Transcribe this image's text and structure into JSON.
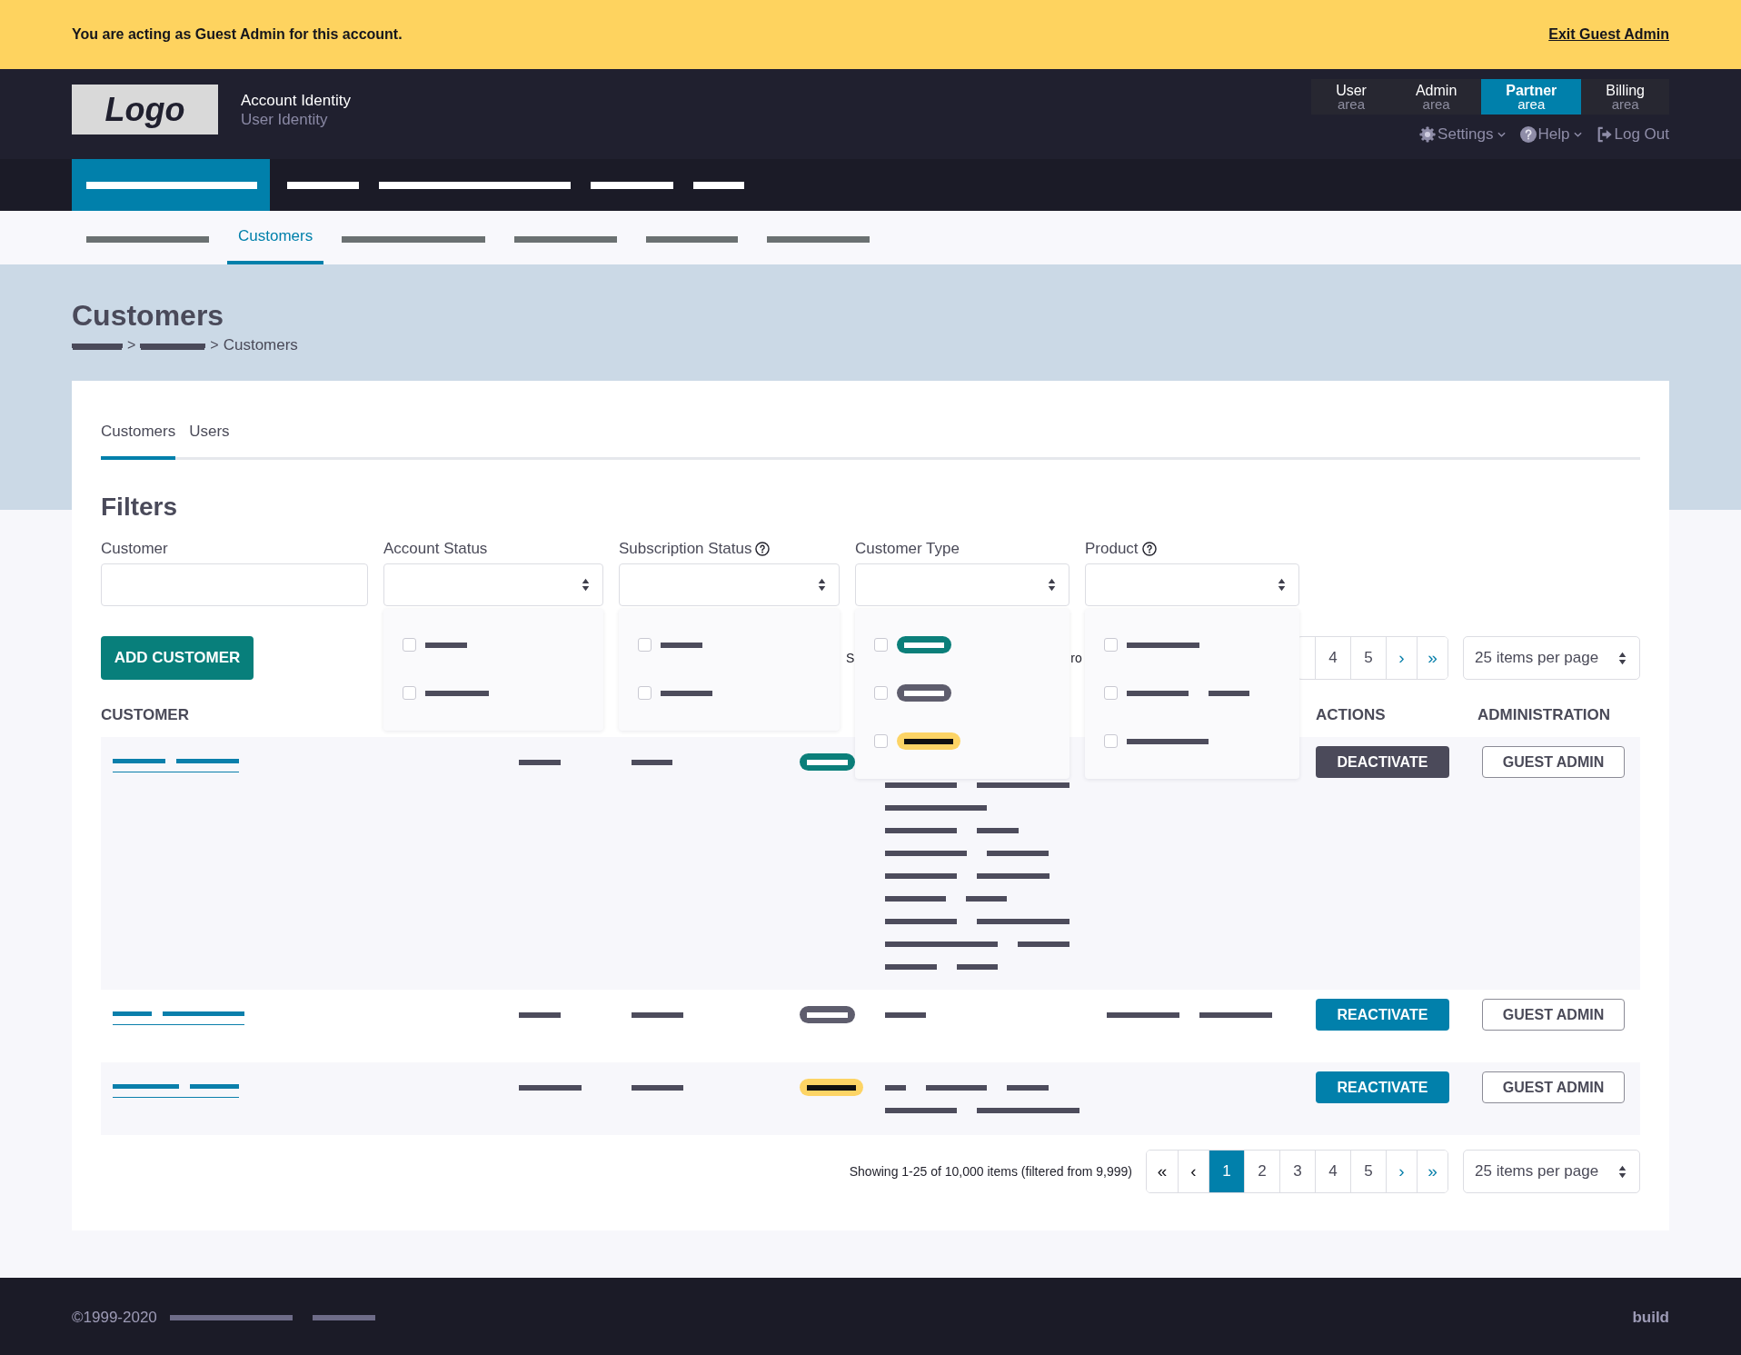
{
  "banner": {
    "message": "You are acting as Guest Admin for this account.",
    "link": "Exit Guest Admin"
  },
  "header": {
    "logo": "Logo",
    "account_name": "Account Identity",
    "user_name": "User Identity",
    "areas": [
      {
        "label": "User",
        "sublabel": "area",
        "selected": false
      },
      {
        "label": "Admin",
        "sublabel": "area",
        "selected": false
      },
      {
        "label": "Partner",
        "sublabel": "area",
        "selected": true
      },
      {
        "label": "Billing",
        "sublabel": "area",
        "selected": false
      }
    ],
    "menu": [
      {
        "kind": "settings",
        "label": "Settings",
        "dropdown": true
      },
      {
        "kind": "help",
        "label": "Help",
        "dropdown": true
      },
      {
        "kind": "logout",
        "label": "Log Out",
        "dropdown": false
      }
    ]
  },
  "main_nav": [
    {
      "kind": "placeholder",
      "selected": true
    },
    {
      "kind": "placeholder",
      "selected": false
    },
    {
      "kind": "placeholder",
      "selected": false
    },
    {
      "kind": "placeholder",
      "selected": false
    },
    {
      "kind": "placeholder",
      "selected": false
    }
  ],
  "sub_nav": [
    {
      "kind": "placeholder",
      "selected": false
    },
    {
      "kind": "text",
      "label": "Customers",
      "selected": true
    },
    {
      "kind": "placeholder",
      "selected": false
    },
    {
      "kind": "placeholder",
      "selected": false
    },
    {
      "kind": "placeholder",
      "selected": false
    },
    {
      "kind": "placeholder",
      "selected": false
    }
  ],
  "page_header": {
    "title": "Customers",
    "breadcrumb": [
      {
        "kind": "placeholder-link"
      },
      {
        "kind": "separator",
        "label": ">"
      },
      {
        "kind": "placeholder-link"
      },
      {
        "kind": "separator",
        "label": ">"
      },
      {
        "kind": "text",
        "label": "Customers"
      }
    ]
  },
  "tabs": [
    {
      "label": "Customers",
      "selected": true
    },
    {
      "label": "Users",
      "selected": false
    }
  ],
  "filters": {
    "title": "Filters",
    "fields": [
      {
        "label": "Customer",
        "kind": "text",
        "help": false,
        "open": false
      },
      {
        "label": "Account Status",
        "kind": "select",
        "help": false,
        "open": true,
        "options": [
          {
            "kind": "placeholder",
            "checked": false
          },
          {
            "kind": "placeholder",
            "checked": false
          }
        ]
      },
      {
        "label": "Subscription Status",
        "kind": "select",
        "help": true,
        "open": true,
        "options": [
          {
            "kind": "placeholder",
            "checked": false
          },
          {
            "kind": "placeholder",
            "checked": false
          }
        ]
      },
      {
        "label": "Customer Type",
        "kind": "select",
        "help": false,
        "open": true,
        "options": [
          {
            "kind": "badge",
            "color": "#0b7f7a",
            "checked": false
          },
          {
            "kind": "badge",
            "color": "#5e5d6d",
            "checked": false
          },
          {
            "kind": "badge",
            "color": "#fdd465",
            "checked": false
          }
        ]
      },
      {
        "label": "Product",
        "kind": "select",
        "help": true,
        "open": true,
        "options": [
          {
            "kind": "placeholder",
            "checked": false
          },
          {
            "kind": "placeholder",
            "checked": false
          },
          {
            "kind": "placeholder",
            "checked": false
          }
        ]
      }
    ]
  },
  "top_toolbar": {
    "add_button": "ADD CUSTOMER",
    "summary_fragments": [
      "S",
      "ro"
    ],
    "pages": [
      {
        "label": "4",
        "kind": "page",
        "selected": false
      },
      {
        "label": "5",
        "kind": "page",
        "selected": false
      },
      {
        "label": "›",
        "kind": "next",
        "selected": false
      },
      {
        "label": "»",
        "kind": "last",
        "selected": false
      }
    ],
    "per_page": "25 items per page"
  },
  "table": {
    "columns": [
      {
        "label": "CUSTOMER",
        "kind": "customer"
      },
      {
        "label": "ACTIONS",
        "kind": "actions"
      },
      {
        "label": "ADMINISTRATION",
        "kind": "administration"
      }
    ],
    "rows": [
      {
        "cells": [
          {
            "kind": "placeholder-link"
          },
          {
            "kind": "placeholder"
          },
          {
            "kind": "placeholder"
          },
          {
            "kind": "badge",
            "color": "#0b7f7a"
          },
          {
            "kind": "placeholder"
          },
          {
            "kind": "empty"
          }
        ],
        "action": {
          "label": "DEACTIVATE",
          "kind": "deactivate"
        },
        "admin_action": "GUEST ADMIN"
      },
      {
        "cells": [
          {
            "kind": "placeholder-link"
          },
          {
            "kind": "placeholder"
          },
          {
            "kind": "placeholder"
          },
          {
            "kind": "badge",
            "color": "#5e5d6d"
          },
          {
            "kind": "placeholder"
          },
          {
            "kind": "placeholder"
          }
        ],
        "action": {
          "label": "REACTIVATE",
          "kind": "reactivate"
        },
        "admin_action": "GUEST ADMIN"
      },
      {
        "cells": [
          {
            "kind": "placeholder-link"
          },
          {
            "kind": "placeholder"
          },
          {
            "kind": "placeholder"
          },
          {
            "kind": "badge",
            "color": "#fdd465"
          },
          {
            "kind": "placeholder"
          },
          {
            "kind": "empty"
          }
        ],
        "action": {
          "label": "REACTIVATE",
          "kind": "reactivate"
        },
        "admin_action": "GUEST ADMIN"
      }
    ]
  },
  "bottom_toolbar": {
    "summary": "Showing 1-25 of 10,000 items (filtered from 9,999)",
    "pages": [
      {
        "label": "«",
        "kind": "first",
        "selected": false
      },
      {
        "label": "‹",
        "kind": "prev",
        "selected": false
      },
      {
        "label": "1",
        "kind": "page",
        "selected": true
      },
      {
        "label": "2",
        "kind": "page",
        "selected": false
      },
      {
        "label": "3",
        "kind": "page",
        "selected": false
      },
      {
        "label": "4",
        "kind": "page",
        "selected": false
      },
      {
        "label": "5",
        "kind": "page",
        "selected": false
      },
      {
        "label": "›",
        "kind": "next",
        "selected": false
      },
      {
        "label": "»",
        "kind": "last",
        "selected": false
      }
    ],
    "per_page": "25 items per page"
  },
  "footer": {
    "copyright": "©1999-2020",
    "links": [
      {
        "kind": "placeholder"
      },
      {
        "kind": "placeholder"
      }
    ],
    "build": "build"
  }
}
